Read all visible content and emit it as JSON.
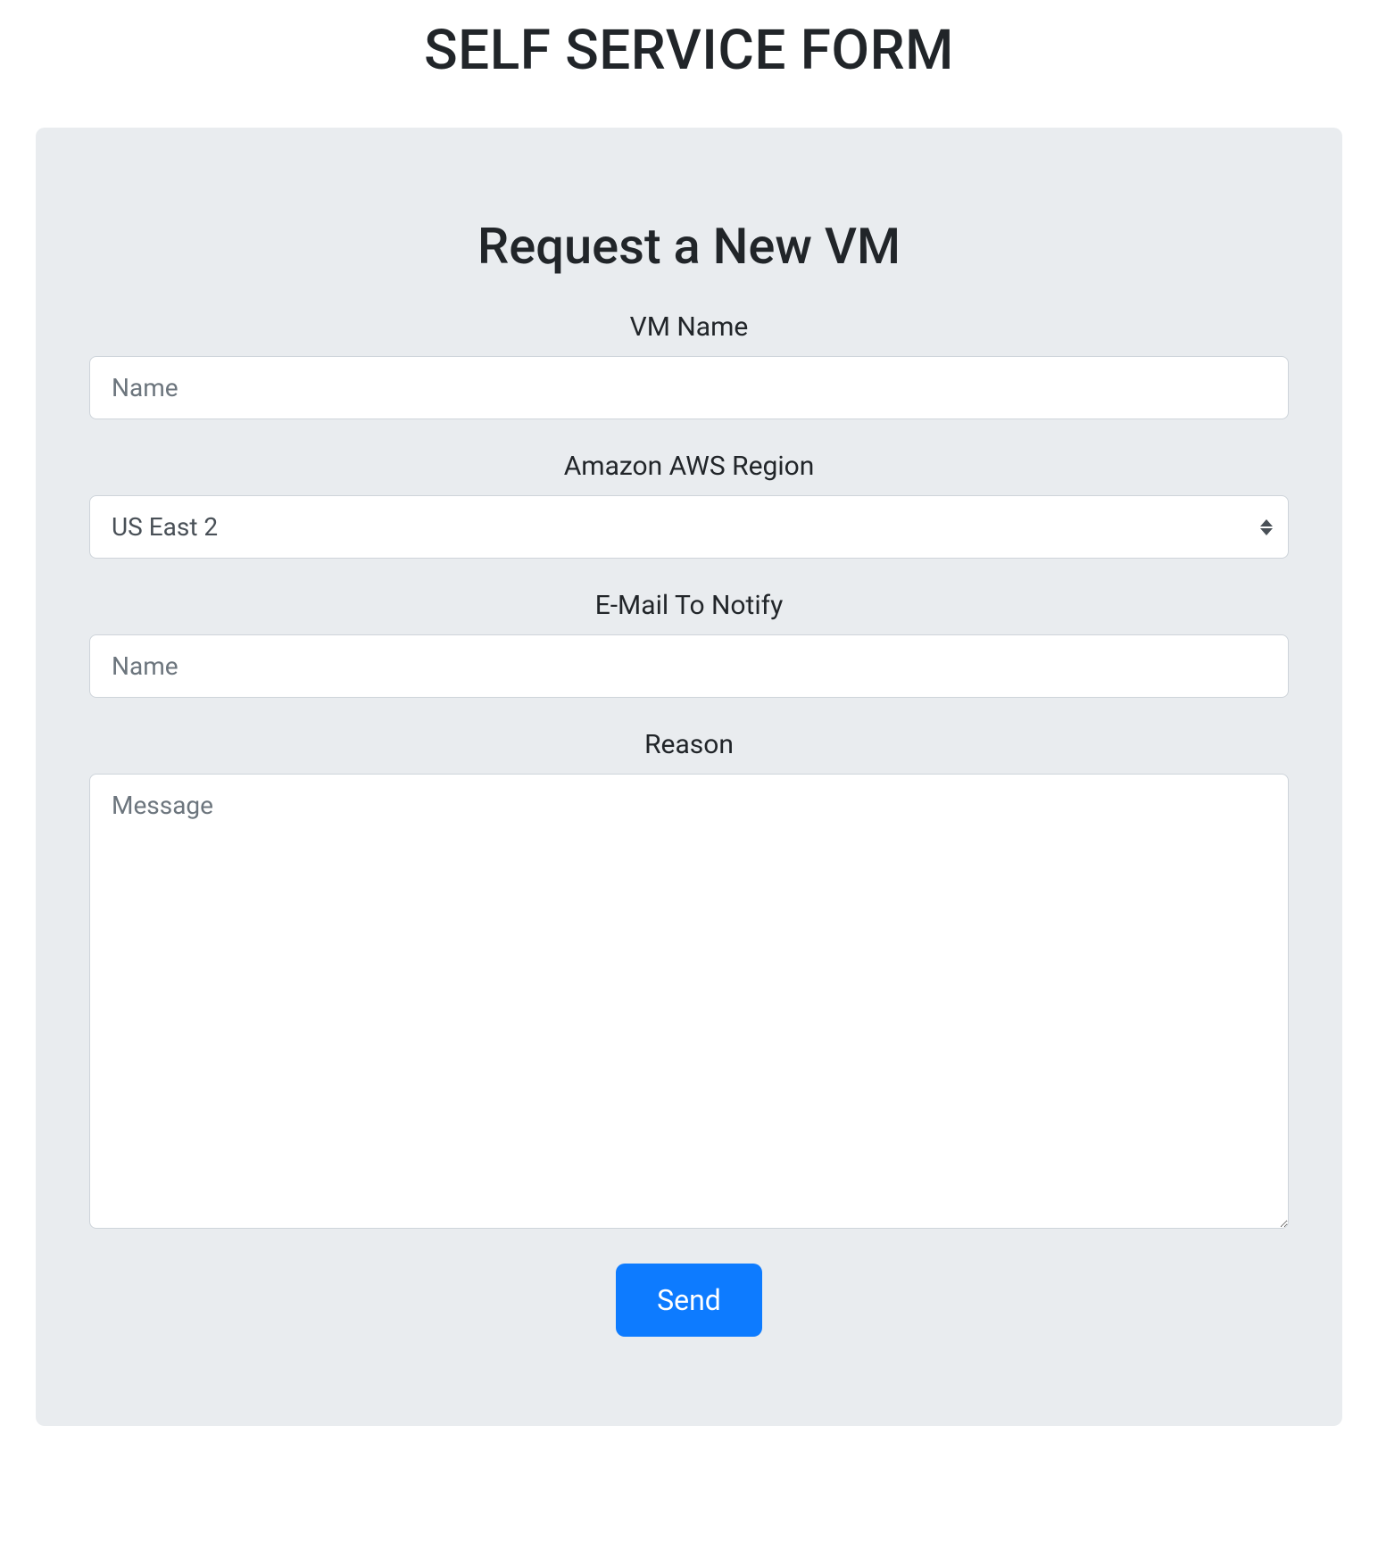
{
  "page": {
    "title": "SELF SERVICE FORM"
  },
  "form": {
    "title": "Request a New VM",
    "fields": {
      "vm_name": {
        "label": "VM Name",
        "placeholder": "Name",
        "value": ""
      },
      "region": {
        "label": "Amazon AWS Region",
        "selected": "US East 2"
      },
      "email": {
        "label": "E-Mail To Notify",
        "placeholder": "Name",
        "value": ""
      },
      "reason": {
        "label": "Reason",
        "placeholder": "Message",
        "value": ""
      }
    },
    "submit_label": "Send"
  }
}
